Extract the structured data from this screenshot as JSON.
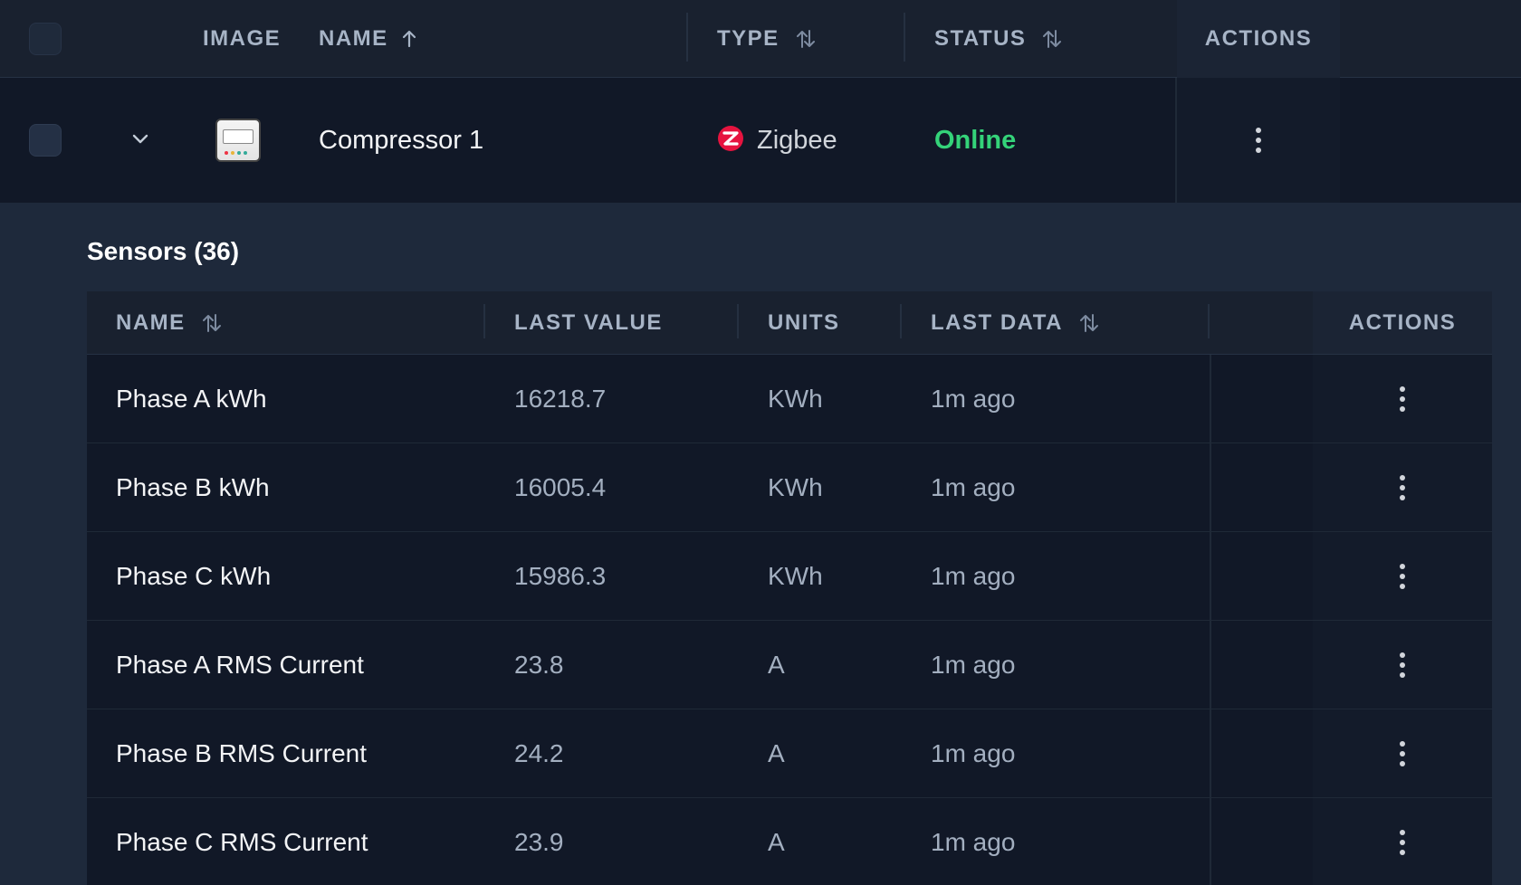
{
  "table": {
    "headers": {
      "image": "IMAGE",
      "name": "NAME",
      "type": "TYPE",
      "status": "STATUS",
      "actions": "ACTIONS"
    },
    "device": {
      "name": "Compressor 1",
      "type": "Zigbee",
      "status": "Online"
    }
  },
  "sensors": {
    "title": "Sensors (36)",
    "headers": {
      "name": "NAME",
      "last_value": "LAST VALUE",
      "units": "UNITS",
      "last_data": "LAST DATA",
      "actions": "ACTIONS"
    },
    "rows": [
      {
        "name": "Phase A kWh",
        "last_value": "16218.7",
        "units": "KWh",
        "last_data": "1m ago"
      },
      {
        "name": "Phase B kWh",
        "last_value": "16005.4",
        "units": "KWh",
        "last_data": "1m ago"
      },
      {
        "name": "Phase C kWh",
        "last_value": "15986.3",
        "units": "KWh",
        "last_data": "1m ago"
      },
      {
        "name": "Phase A RMS Current",
        "last_value": "23.8",
        "units": "A",
        "last_data": "1m ago"
      },
      {
        "name": "Phase B RMS Current",
        "last_value": "24.2",
        "units": "A",
        "last_data": "1m ago"
      },
      {
        "name": "Phase C RMS Current",
        "last_value": "23.9",
        "units": "A",
        "last_data": "1m ago"
      }
    ]
  },
  "colors": {
    "online": "#34d379",
    "zigbee": "#e6133f",
    "page_bg": "#1e293b",
    "row_bg": "#111827"
  },
  "icons": {
    "sort_asc": "arrow-up-icon",
    "sort_both": "sort-arrows-icon",
    "expand": "chevron-down-icon",
    "menu": "kebab-menu-icon",
    "type": "zigbee-logo-icon"
  }
}
